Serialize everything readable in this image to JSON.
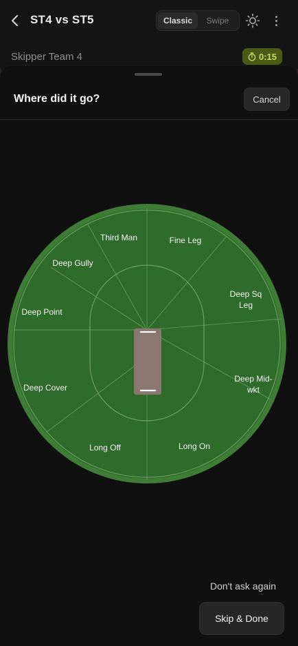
{
  "header": {
    "title": "ST4 vs ST5",
    "mode_options": [
      {
        "label": "Classic",
        "active": true
      },
      {
        "label": "Swipe",
        "active": false
      }
    ],
    "icons": [
      "back-chevron-icon",
      "brightness-icon",
      "more-vertical-icon"
    ]
  },
  "subheader": {
    "team_name": "Skipper Team 4",
    "timer": "0:15",
    "timer_icon": "stopwatch-icon"
  },
  "sheet": {
    "title": "Where did it go?",
    "cancel_label": "Cancel"
  },
  "field": {
    "zones": [
      {
        "id": "third-man",
        "label": "Third Man"
      },
      {
        "id": "fine-leg",
        "label": "Fine Leg"
      },
      {
        "id": "deep-gully",
        "label": "Deep Gully"
      },
      {
        "id": "deep-sq-leg",
        "label": "Deep Sq Leg",
        "lines": [
          "Deep Sq",
          "Leg"
        ]
      },
      {
        "id": "deep-point",
        "label": "Deep Point"
      },
      {
        "id": "deep-cover",
        "label": "Deep Cover"
      },
      {
        "id": "deep-mid-wkt",
        "label": "Deep Mid-wkt",
        "lines": [
          "Deep Mid-",
          "wkt"
        ]
      },
      {
        "id": "long-off",
        "label": "Long Off"
      },
      {
        "id": "long-on",
        "label": "Long On"
      }
    ],
    "colors": {
      "grass": "#2f6b2a",
      "boundary": "#3f7d36",
      "pitch": "#8b7670",
      "lines": "#6f9f66"
    }
  },
  "footer": {
    "dont_ask_label": "Don't ask again",
    "skip_done_label": "Skip & Done"
  }
}
